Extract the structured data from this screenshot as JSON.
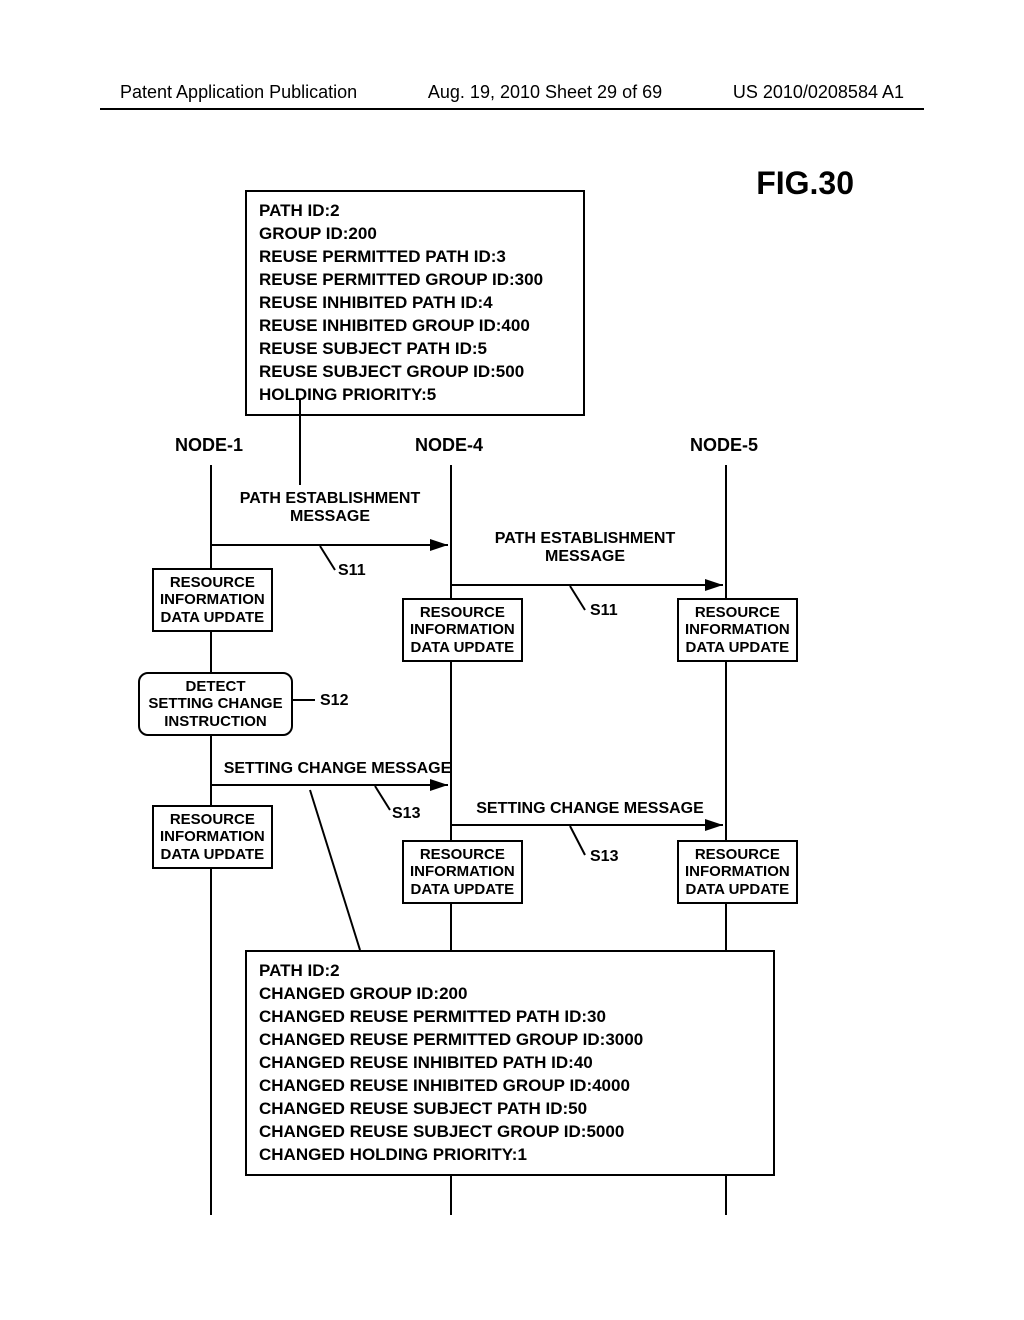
{
  "header": {
    "left": "Patent Application Publication",
    "center": "Aug. 19, 2010  Sheet 29 of 69",
    "right": "US 2010/0208584 A1"
  },
  "figure_title": "FIG.30",
  "infobox_top": {
    "l1": "PATH ID:2",
    "l2": "GROUP ID:200",
    "l3": "REUSE PERMITTED PATH ID:3",
    "l4": "REUSE PERMITTED GROUP ID:300",
    "l5": "REUSE INHIBITED PATH ID:4",
    "l6": "REUSE INHIBITED GROUP ID:400",
    "l7": "REUSE SUBJECT PATH ID:5",
    "l8": "REUSE SUBJECT GROUP ID:500",
    "l9": "HOLDING PRIORITY:5"
  },
  "infobox_bottom": {
    "l1": "PATH ID:2",
    "l2": "CHANGED GROUP ID:200",
    "l3": "CHANGED REUSE PERMITTED PATH ID:30",
    "l4": "CHANGED REUSE PERMITTED GROUP ID:3000",
    "l5": "CHANGED REUSE INHIBITED PATH ID:40",
    "l6": "CHANGED REUSE INHIBITED GROUP ID:4000",
    "l7": "CHANGED REUSE SUBJECT PATH ID:50",
    "l8": "CHANGED REUSE SUBJECT GROUP ID:5000",
    "l9": "CHANGED HOLDING PRIORITY:1"
  },
  "nodes": {
    "n1": "NODE-1",
    "n4": "NODE-4",
    "n5": "NODE-5"
  },
  "messages": {
    "pem1": "PATH ESTABLISHMENT\nMESSAGE",
    "pem2": "PATH ESTABLISHMENT\nMESSAGE",
    "scm1": "SETTING CHANGE MESSAGE",
    "scm2": "SETTING CHANGE MESSAGE"
  },
  "steps": {
    "s11a": "S11",
    "s11b": "S11",
    "s12": "S12",
    "s13a": "S13",
    "s13b": "S13"
  },
  "proc": {
    "ridu": "RESOURCE\nINFORMATION\nDATA UPDATE",
    "detect": "DETECT\nSETTING CHANGE\nINSTRUCTION"
  }
}
